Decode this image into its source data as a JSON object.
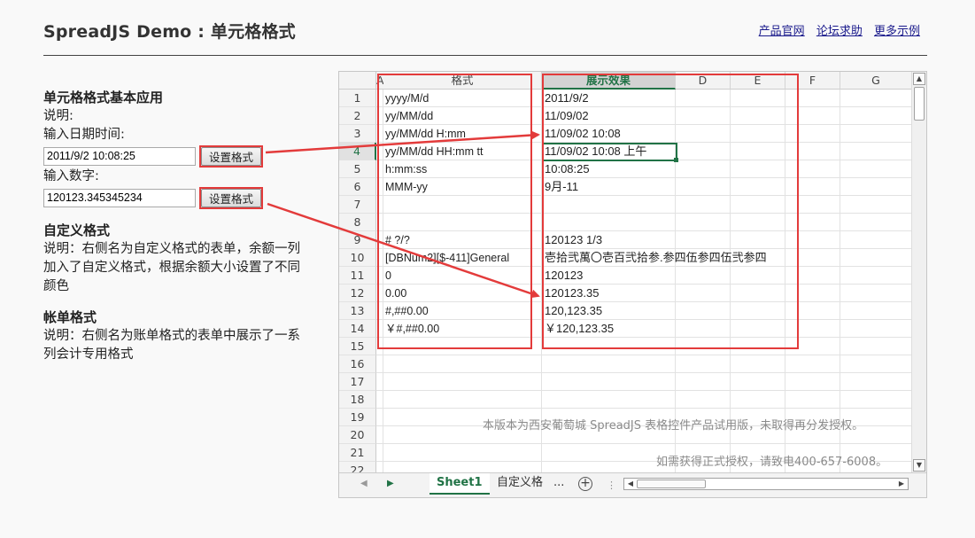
{
  "header": {
    "title": "SpreadJS Demo : 单元格格式",
    "links": [
      "产品官网",
      "论坛求助",
      "更多示例"
    ]
  },
  "left": {
    "basic_title": "单元格格式基本应用",
    "desc_label": "说明:",
    "date_label": "输入日期时间:",
    "date_value": "2011/9/2 10:08:25",
    "number_label": "输入数字:",
    "number_value": "120123.345345234",
    "set_format_label": "设置格式",
    "custom_title": "自定义格式",
    "custom_desc": "说明：右侧名为自定义格式的表单，余额一列加入了自定义格式，根据余额大小设置了不同颜色",
    "bill_title": "帐单格式",
    "bill_desc": "说明：右侧名为账单格式的表单中展示了一系列会计专用格式"
  },
  "sheet": {
    "columns": [
      "A",
      "格式",
      "展示效果",
      "D",
      "E",
      "F",
      "G"
    ],
    "rows": [
      "1",
      "2",
      "3",
      "4",
      "5",
      "6",
      "7",
      "8",
      "9",
      "10",
      "11",
      "12",
      "13",
      "14",
      "15",
      "16",
      "17",
      "18",
      "19",
      "20",
      "21",
      "22"
    ],
    "active_row": "4",
    "format_col": [
      "yyyy/M/d",
      "yy/MM/dd",
      "yy/MM/dd H:mm",
      "yy/MM/dd HH:mm tt",
      "h:mm:ss",
      "MMM-yy",
      "",
      "",
      "# ?/?",
      "[DBNum2][$-411]General",
      "0",
      "0.00",
      "#,##0.00",
      "￥#,##0.00"
    ],
    "result_col": [
      "2011/9/2",
      "11/09/02",
      "11/09/02 10:08",
      "11/09/02 10:08 上午",
      "10:08:25",
      "9月-11",
      "",
      "",
      "120123 1/3",
      "壱拾弐萬〇壱百弐拾参.参四伍参四伍弐参四",
      "120123",
      "120123.35",
      "120,123.35",
      "￥120,123.35"
    ],
    "watermark1": "本版本为西安葡萄城 SpreadJS 表格控件产品试用版，未取得再分发授权。",
    "watermark2": "如需获得正式授权，请致电400-657-6008。",
    "tabs": [
      "Sheet1",
      "自定义格",
      "..."
    ],
    "colors": {
      "accent": "#217346",
      "annotation": "#e33b3b"
    }
  }
}
